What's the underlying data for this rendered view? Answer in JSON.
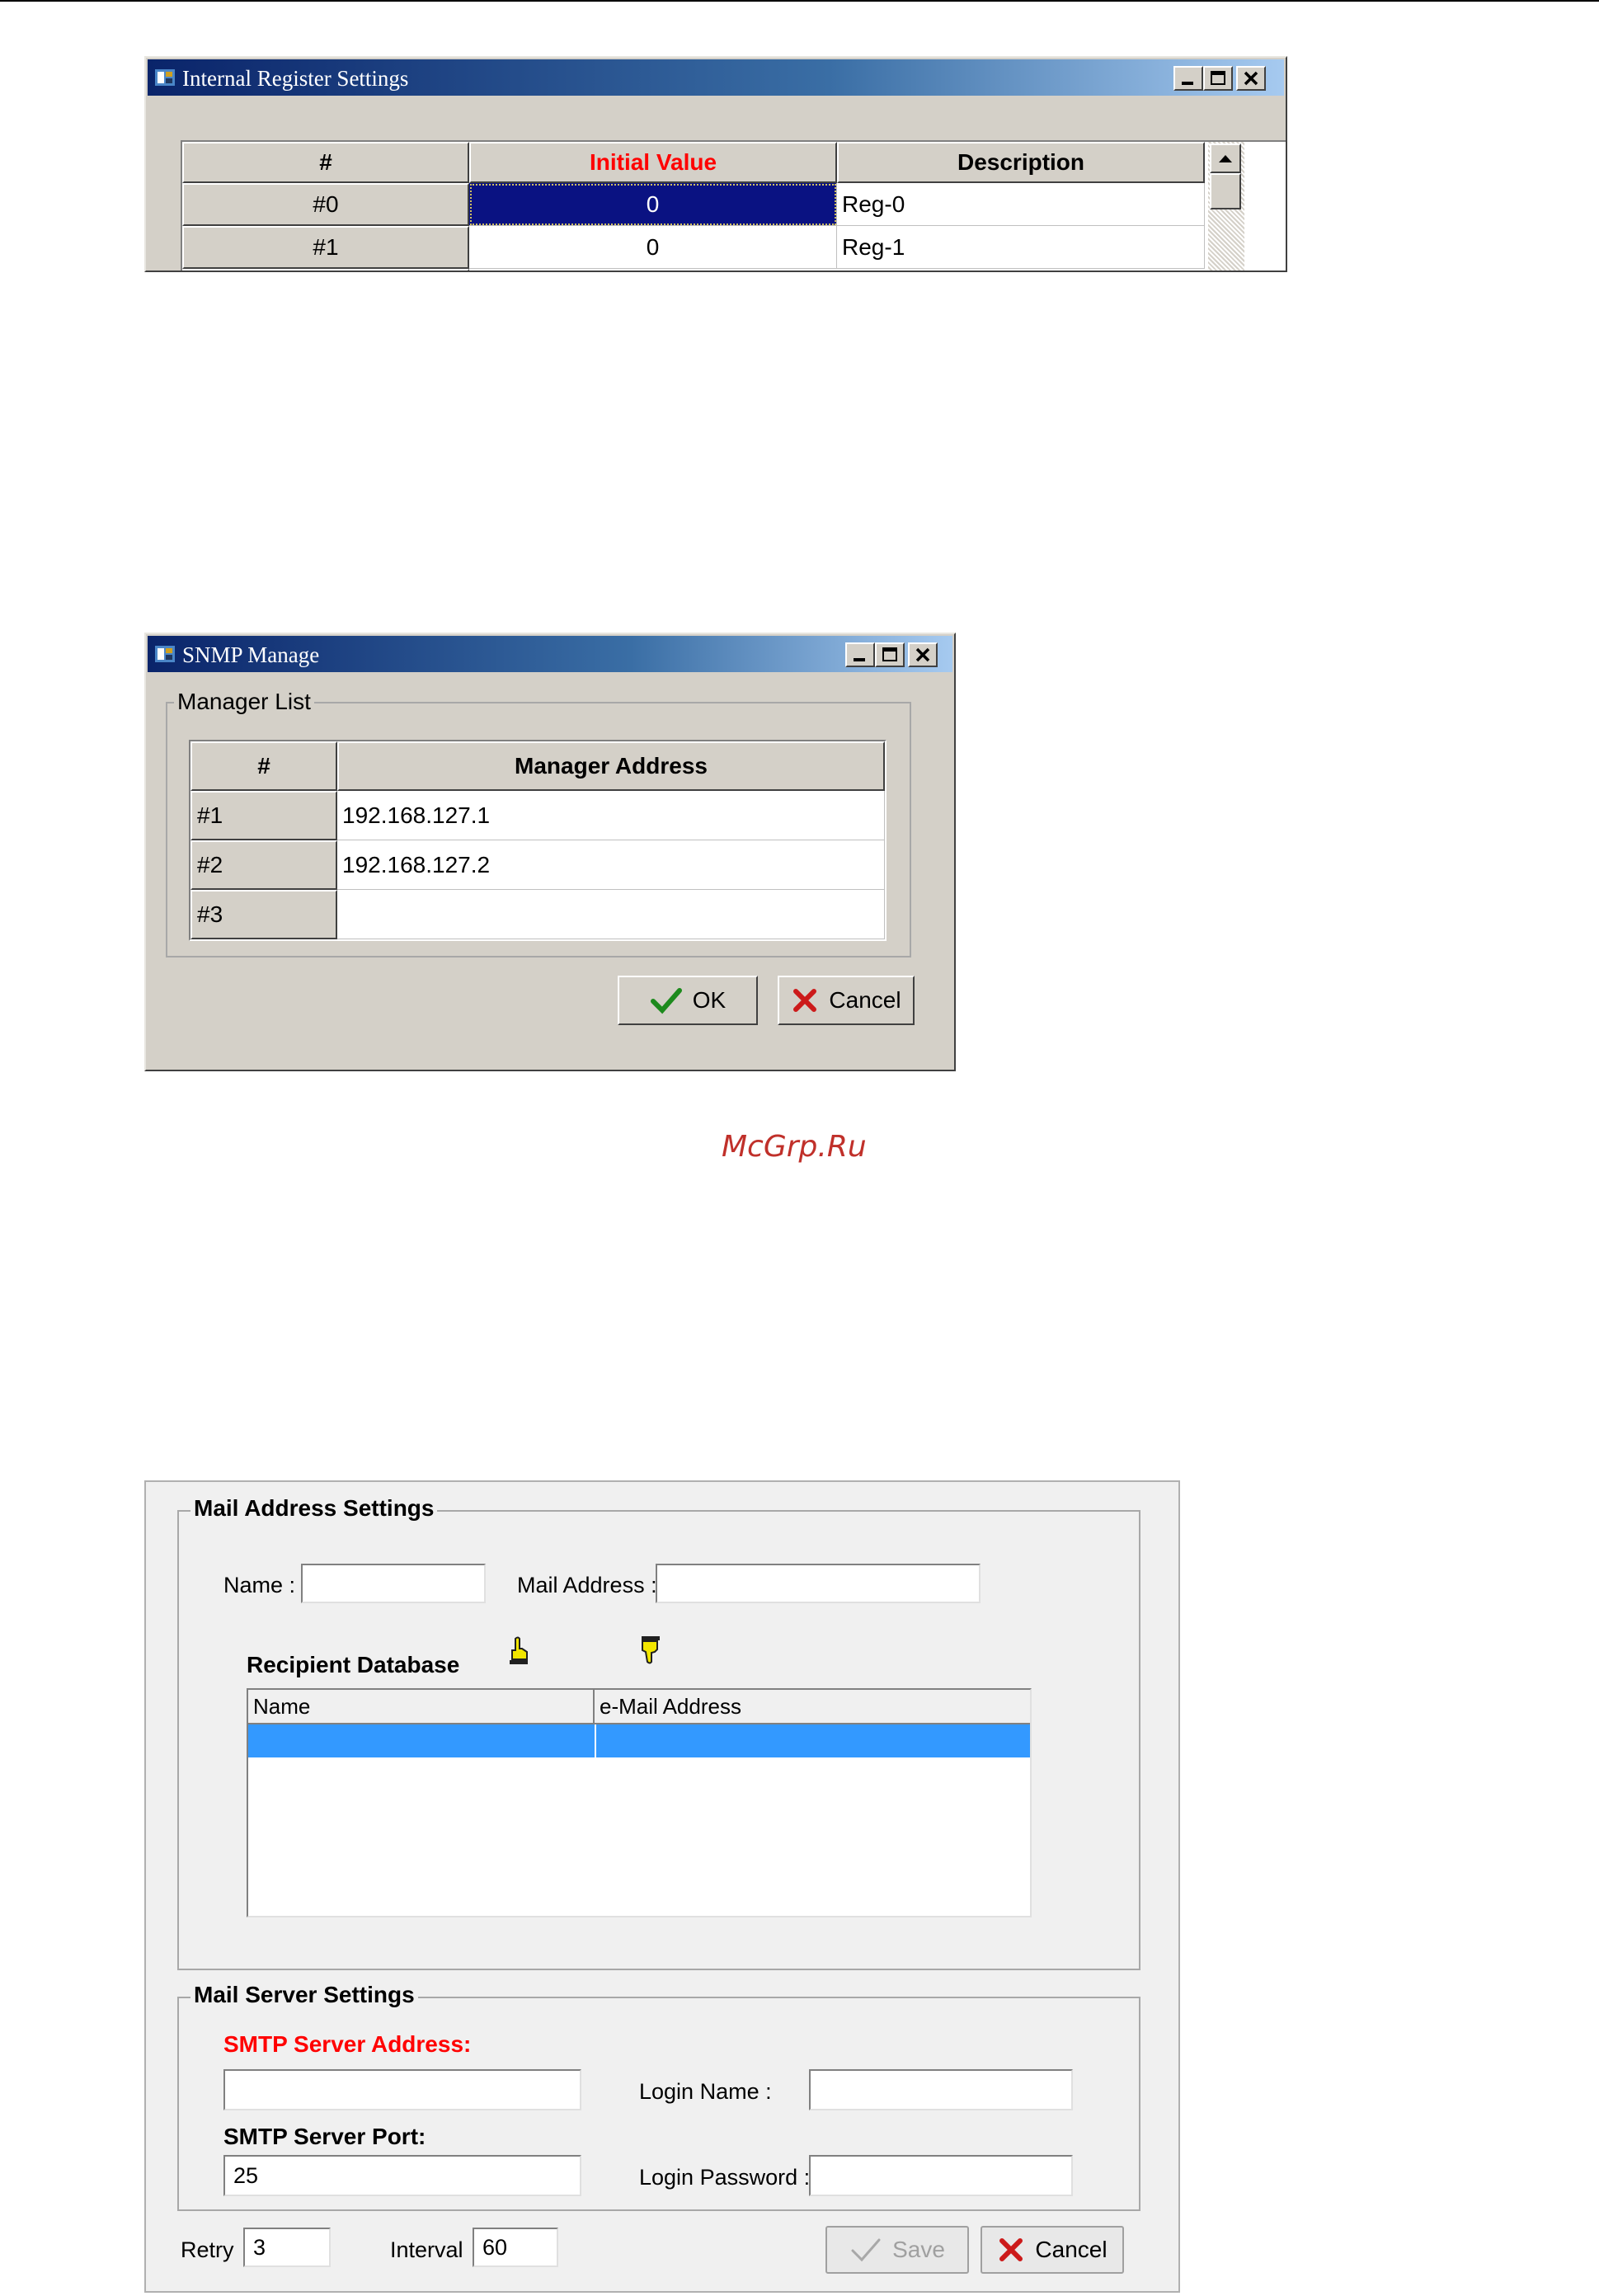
{
  "colors": {
    "title_gradient_start": "#0a246a",
    "title_gradient_end": "#a6caf0",
    "selected_cell": "#0a1282",
    "highlight_header": "#ff0000",
    "selected_row": "#3399ff",
    "watermark": "#c0302a"
  },
  "register_window": {
    "title": "Internal Register Settings",
    "columns": [
      "#",
      "Initial Value",
      "Description"
    ],
    "rows": [
      {
        "num": "#0",
        "value": "0",
        "desc": "Reg-0"
      },
      {
        "num": "#1",
        "value": "0",
        "desc": "Reg-1"
      }
    ]
  },
  "snmp_window": {
    "title": "SNMP Manage",
    "group_label": "Manager List",
    "columns": [
      "#",
      "Manager Address"
    ],
    "rows": [
      {
        "num": "#1",
        "address": "192.168.127.1"
      },
      {
        "num": "#2",
        "address": "192.168.127.2"
      },
      {
        "num": "#3",
        "address": ""
      }
    ],
    "ok_label": "OK",
    "cancel_label": "Cancel"
  },
  "watermark": "McGrp.Ru",
  "mail_window": {
    "address_group_label": "Mail Address Settings",
    "name_label": "Name :",
    "name_value": "",
    "mail_address_label": "Mail Address :",
    "mail_address_value": "",
    "recipient_db_label": "Recipient Database",
    "add_icon": "hand-up-icon",
    "remove_icon": "hand-down-icon",
    "table_columns": [
      "Name",
      "e-Mail Address"
    ],
    "server_group_label": "Mail Server Settings",
    "smtp_address_label": "SMTP Server Address:",
    "smtp_address_value": "",
    "login_name_label": "Login Name :",
    "login_name_value": "",
    "smtp_port_label": "SMTP Server Port:",
    "smtp_port_value": "25",
    "login_password_label": "Login Password :",
    "login_password_value": "",
    "retry_label": "Retry",
    "retry_value": "3",
    "interval_label": "Interval",
    "interval_value": "60",
    "save_label": "Save",
    "cancel_label": "Cancel"
  }
}
